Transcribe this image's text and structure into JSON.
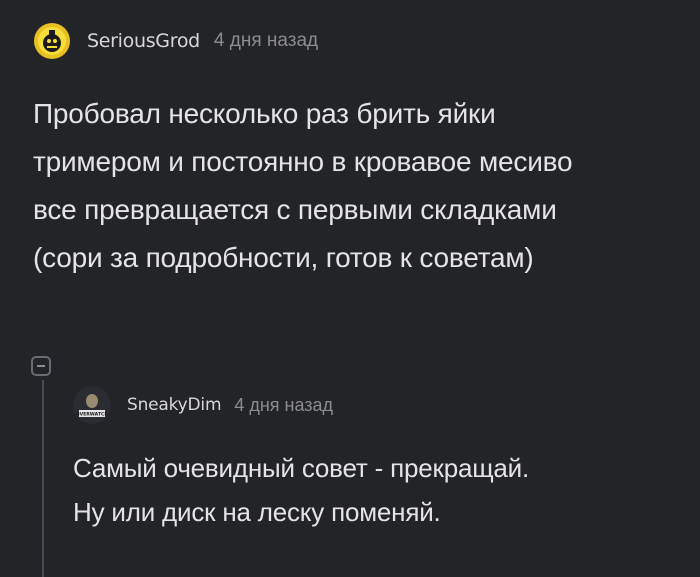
{
  "comment": {
    "author": "SeriousGrod",
    "time": "4 дня назад",
    "avatar_icon": "serious-sam-bomb-icon",
    "lines": [
      "Пробовал несколько раз брить яйки",
      "тримером и постоянно в кровавое месиво",
      "все превращается с первыми складками",
      "(сори за подробности, готов к советам)"
    ]
  },
  "reply": {
    "author": "SneakyDim",
    "time": "4 дня назад",
    "avatar_icon": "character-avatar-icon",
    "avatar_caption": "OVERWATCH",
    "lines": [
      "Самый очевидный совет - прекращай.",
      "Ну или диск на леску поменяй."
    ]
  },
  "colors": {
    "background": "#232428",
    "text": "#e4e4e4",
    "muted": "#8c8c90",
    "thread_line": "#4a4b50"
  }
}
